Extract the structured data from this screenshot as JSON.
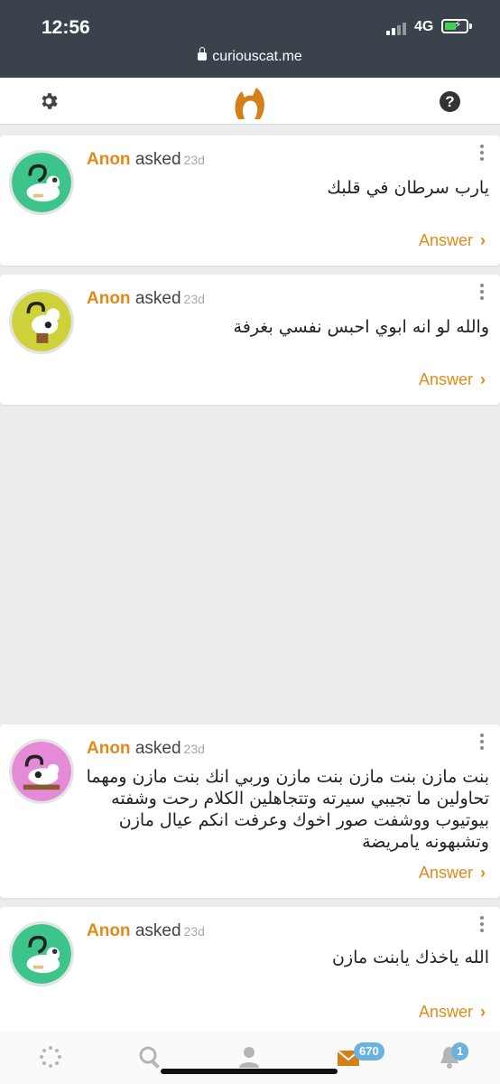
{
  "status_bar": {
    "time": "12:56",
    "network": "4G",
    "url": "curiouscat.me"
  },
  "header": {
    "settings_icon": "gear-icon",
    "logo": "curiouscat-logo",
    "help_icon": "question-icon",
    "brand_color": "#d57f1a"
  },
  "posts": [
    {
      "name": "Anon",
      "verb": "asked",
      "time": "23d",
      "question": "يارب سرطان في قلبك",
      "answer_label": "Answer",
      "avatar_color": "#3cc48a"
    },
    {
      "name": "Anon",
      "verb": "asked",
      "time": "23d",
      "question": "والله لو انه ابوي احبس نفسي بغرفة",
      "answer_label": "Answer",
      "avatar_color": "#cfd13a"
    },
    {
      "name": "Anon",
      "verb": "asked",
      "time": "23d",
      "question": "بنت مازن بنت مازن بنت مازن وربي انك بنت مازن ومهما تحاولين ما تجيبي سيرته وتتجاهلين الكلام رحت وشفته بيوتيوب ووشفت صور اخوك وعرفت انكم عيال مازن وتشبهونه يامريضة",
      "answer_label": "Answer",
      "avatar_color": "#e48ad6"
    },
    {
      "name": "Anon",
      "verb": "asked",
      "time": "23d",
      "question": "الله ياخذك يابنت مازن",
      "answer_label": "Answer",
      "avatar_color": "#3cc48a"
    }
  ],
  "bottom_nav": {
    "items": [
      "loading-icon",
      "search-icon",
      "profile-icon",
      "inbox-icon",
      "notifications-icon"
    ],
    "inbox_count": "670",
    "notifications_count": "1"
  },
  "colors": {
    "accent": "#e18a1a",
    "badge": "#6ab2e0",
    "status_bar": "#3a434c"
  }
}
